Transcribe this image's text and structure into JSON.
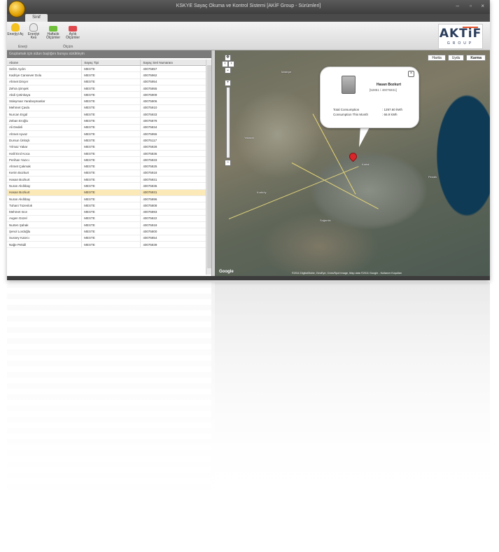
{
  "window": {
    "title": "KSKYE Sayaç Okuma ve Kontrol Sistemi [AKİF Group - Sürümleri]",
    "minimize": "–",
    "maximize": "▫",
    "close": "×"
  },
  "ribbon": {
    "tab": "Sinif",
    "buttons": [
      {
        "label": "Enerjiyi Aç",
        "icon": "bulb-on-icon",
        "color": "#f3c21e"
      },
      {
        "label": "Enerjiyi Kes",
        "icon": "bulb-off-icon",
        "color": "#e8e8e8"
      },
      {
        "label": "Haftalık Ölçümler",
        "icon": "green-chart-icon",
        "color": "#6fbf3a"
      },
      {
        "label": "Aylık Ölçümler",
        "icon": "red-chart-icon",
        "color": "#e0474c"
      }
    ],
    "groups": [
      "Enerji",
      "Ölçüm"
    ],
    "logo_text": "AKTiF",
    "logo_sub": "GROUP"
  },
  "grid": {
    "group_bar": "Gruplamak için sütun başlığını buraya sürükleyin",
    "columns": [
      "Abone",
      "Sayaç Tipi",
      "Sayaç Seri Numarası"
    ],
    "selected_index": 19,
    "rows": [
      [
        "Selim Aydın",
        "MESTE",
        "40075857"
      ],
      [
        "Kadriye Cansever Dolu",
        "MESTE",
        "40075962"
      ],
      [
        "Ahmet Dinçer",
        "MESTE",
        "40075954"
      ],
      [
        "Zehra Şimşek",
        "MESTE",
        "40075955"
      ],
      [
        "Abdi Çetinkaya",
        "MESTE",
        "40075909"
      ],
      [
        "Süleyman Yaraboşmanlar",
        "MESTE",
        "40075906"
      ],
      [
        "Mehmet Çavla",
        "MESTE",
        "40075910"
      ],
      [
        "Nurcan Ergül",
        "MESTE",
        "40075933"
      ],
      [
        "Zeban Eroğlu",
        "MESTE",
        "40075878"
      ],
      [
        "Ali Dedeli",
        "MESTE",
        "40075834"
      ],
      [
        "Ahmet Ayvaz",
        "MESTE",
        "40075955"
      ],
      [
        "Dursun Ünlüçk",
        "MESTE",
        "40075117"
      ],
      [
        "Yılmaz Yakar",
        "MESTE",
        "40075928"
      ],
      [
        "Halil Erol Koca",
        "MESTE",
        "40075836"
      ],
      [
        "Perihan Yazıcı",
        "MESTE",
        "40075933"
      ],
      [
        "Ahmet Çakmak",
        "MESTE",
        "40075825"
      ],
      [
        "Kerim Bozkurt",
        "MESTE",
        "40075918"
      ],
      [
        "Hasan Bozkurt",
        "MESTE",
        "40075931"
      ],
      [
        "Nuran Akıllıbay",
        "MESTE",
        "40075836"
      ],
      [
        "Hasan Bozkurt",
        "MESTE",
        "40075931"
      ],
      [
        "Nuran Akıllıbay",
        "MESTE",
        "40075896"
      ],
      [
        "Tuhani Tüzenlok",
        "MESTE",
        "40075808"
      ],
      [
        "Mehmet Ince",
        "MESTE",
        "40075893"
      ],
      [
        "Avgen Güzel",
        "MESTE",
        "40075822"
      ],
      [
        "Nurten Şahak",
        "MESTE",
        "40075918"
      ],
      [
        "Şenol Lordoğlu",
        "MESTE",
        "40075800"
      ],
      [
        "Sussey Katırcı",
        "MESTE",
        "40075854"
      ],
      [
        "Nağe Pekdil",
        "MESTE",
        "40075839"
      ]
    ]
  },
  "map": {
    "types": [
      "Harita",
      "Uydu",
      "Karma"
    ],
    "active_type": "Karma",
    "zoom_in": "+",
    "zoom_out": "−",
    "pan": "✥",
    "popup": {
      "name": "Hasan Bozkurt",
      "code": "[52851 / 40075931]",
      "total_label": "Total Consumption",
      "total_value": ": 1297.60 kWh",
      "month_label": "Consumption This Month",
      "month_value": ": 66.9 kWh",
      "close": "×"
    },
    "labels": [
      "Maltepe",
      "Yakacık",
      "Kartal",
      "Pendik",
      "Kurtköy",
      "Soğanlık"
    ],
    "copyright": "©2011 DigitalGlobe, GeoEye, Cnes/Spot Image, Map data ©2011 Google - Kullanım Koşulları",
    "google": "Google"
  }
}
